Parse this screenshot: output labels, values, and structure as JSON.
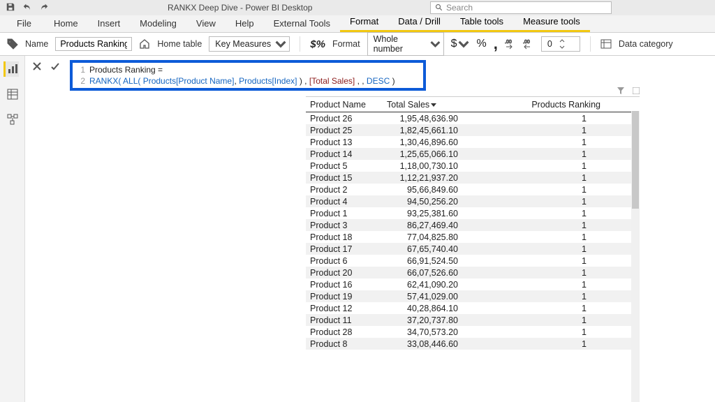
{
  "titlebar": {
    "title": "RANKX Deep Dive - Power BI Desktop",
    "search_placeholder": "Search"
  },
  "tabs": {
    "file": "File",
    "home": "Home",
    "insert": "Insert",
    "modeling": "Modeling",
    "view": "View",
    "help": "Help",
    "external": "External Tools",
    "format": "Format",
    "data_drill": "Data / Drill",
    "table_tools": "Table tools",
    "measure_tools": "Measure tools"
  },
  "ribbon": {
    "name_label": "Name",
    "name_value": "Products Ranking",
    "home_table_label": "Home table",
    "home_table_value": "Key Measures",
    "format_label": "Format",
    "format_value": "Whole number",
    "currency": "$",
    "percent": "%",
    "comma": ",",
    "dec_value": "0",
    "data_category": "Data category"
  },
  "formula": {
    "line1": "Products Ranking =",
    "line2_fn": "RANKX(",
    "line2_all": " ALL(",
    "line2_col1": " Products[Product Name]",
    "line2_sep1": ", ",
    "line2_col2": "Products[Index]",
    "line2_close1": " )",
    "line2_sep2": " , ",
    "line2_meas": "[Total Sales]",
    "line2_sep3": " , , ",
    "line2_order": "DESC",
    "line2_close2": " )"
  },
  "table": {
    "headers": {
      "c1": "Product Name",
      "c2": "Total Sales",
      "c3": "Products Ranking"
    },
    "rows": [
      {
        "c1": "Product 26",
        "c2": "1,95,48,636.90",
        "c3": "1"
      },
      {
        "c1": "Product 25",
        "c2": "1,82,45,661.10",
        "c3": "1"
      },
      {
        "c1": "Product 13",
        "c2": "1,30,46,896.60",
        "c3": "1"
      },
      {
        "c1": "Product 14",
        "c2": "1,25,65,066.10",
        "c3": "1"
      },
      {
        "c1": "Product 5",
        "c2": "1,18,00,730.10",
        "c3": "1"
      },
      {
        "c1": "Product 15",
        "c2": "1,12,21,937.20",
        "c3": "1"
      },
      {
        "c1": "Product 2",
        "c2": "95,66,849.60",
        "c3": "1"
      },
      {
        "c1": "Product 4",
        "c2": "94,50,256.20",
        "c3": "1"
      },
      {
        "c1": "Product 1",
        "c2": "93,25,381.60",
        "c3": "1"
      },
      {
        "c1": "Product 3",
        "c2": "86,27,469.40",
        "c3": "1"
      },
      {
        "c1": "Product 18",
        "c2": "77,04,825.80",
        "c3": "1"
      },
      {
        "c1": "Product 17",
        "c2": "67,65,740.40",
        "c3": "1"
      },
      {
        "c1": "Product 6",
        "c2": "66,91,524.50",
        "c3": "1"
      },
      {
        "c1": "Product 20",
        "c2": "66,07,526.60",
        "c3": "1"
      },
      {
        "c1": "Product 16",
        "c2": "62,41,090.20",
        "c3": "1"
      },
      {
        "c1": "Product 19",
        "c2": "57,41,029.00",
        "c3": "1"
      },
      {
        "c1": "Product 12",
        "c2": "40,28,864.10",
        "c3": "1"
      },
      {
        "c1": "Product 11",
        "c2": "37,20,737.80",
        "c3": "1"
      },
      {
        "c1": "Product 28",
        "c2": "34,70,573.20",
        "c3": "1"
      },
      {
        "c1": "Product 8",
        "c2": "33,08,446.60",
        "c3": "1"
      }
    ]
  }
}
